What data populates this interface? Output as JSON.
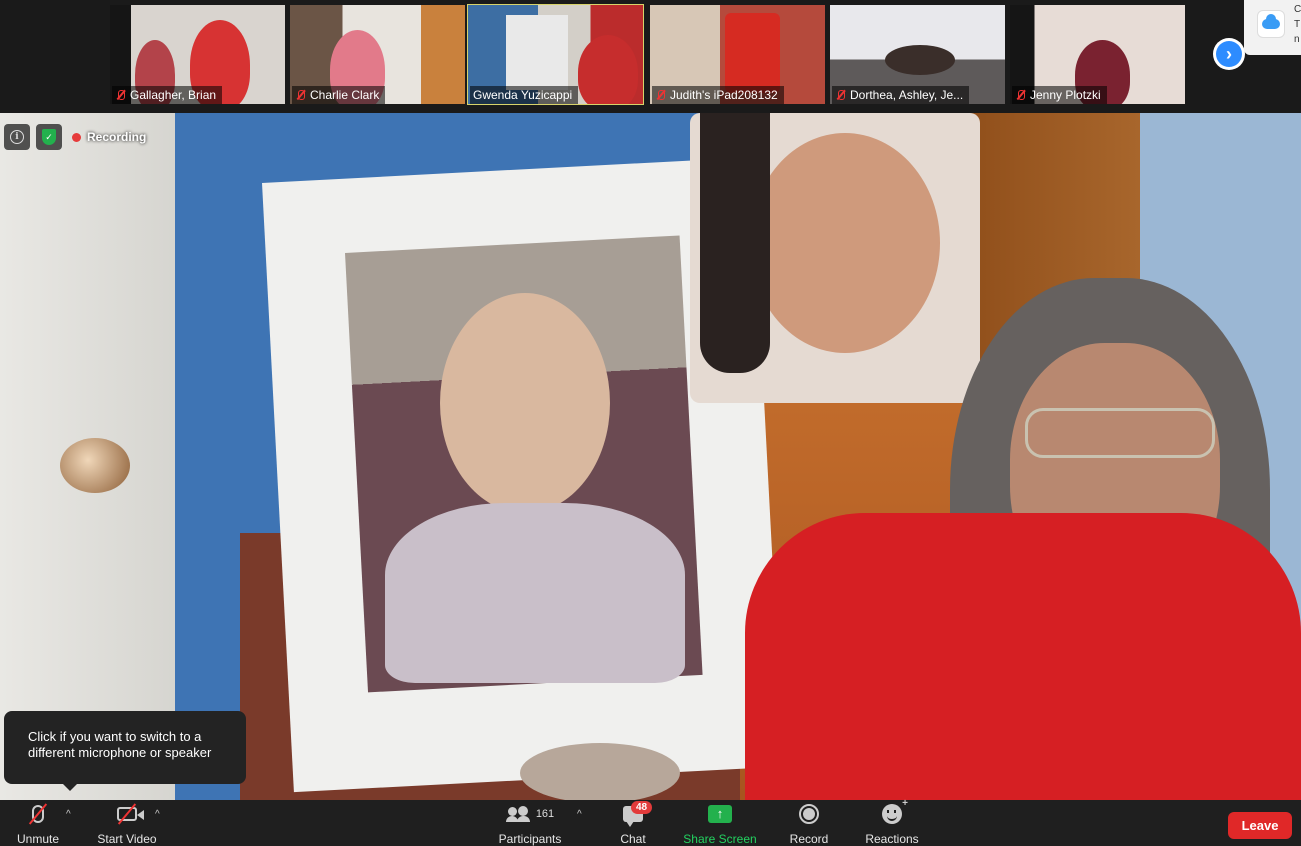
{
  "participants_strip": [
    {
      "name": "Gallagher, Brian",
      "active": false
    },
    {
      "name": "Charlie Clark",
      "active": false
    },
    {
      "name": "Gwenda Yuzicappi",
      "active": true
    },
    {
      "name": "Judith's iPad208132",
      "active": false
    },
    {
      "name": "Dorthea, Ashley, Je...",
      "active": false
    },
    {
      "name": "Jenny Plotzki",
      "active": false
    }
  ],
  "notification": {
    "line1": "C",
    "line2": "T",
    "line3": "n"
  },
  "recording": {
    "label": "Recording"
  },
  "tooltip": {
    "text": "Click if you want to switch to a different microphone or speaker"
  },
  "toolbar": {
    "unmute": "Unmute",
    "start_video": "Start Video",
    "participants": "Participants",
    "participants_count": "161",
    "chat": "Chat",
    "chat_badge": "48",
    "share_screen": "Share Screen",
    "record": "Record",
    "reactions": "Reactions",
    "leave": "Leave"
  },
  "colors": {
    "accent_blue": "#2d8cff",
    "share_green": "#23b14d",
    "leave_red": "#e02828",
    "active_border": "#d8d36a"
  }
}
